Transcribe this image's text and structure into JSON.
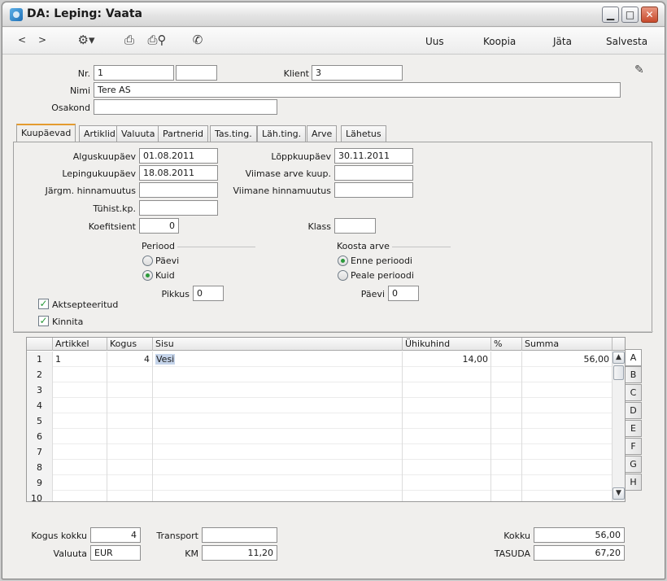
{
  "window": {
    "title": "DA: Leping: Vaata"
  },
  "toolbar": {
    "back": "<",
    "forward": ">",
    "new": "Uus",
    "copy": "Koopia",
    "skip": "Jäta",
    "save": "Salvesta"
  },
  "header": {
    "nr_label": "Nr.",
    "nr_value": "1",
    "nr_value2": "",
    "client_label": "Klient",
    "client_value": "3",
    "name_label": "Nimi",
    "name_value": "Tere AS",
    "dept_label": "Osakond",
    "dept_value": ""
  },
  "tabs": [
    "Kuupäevad",
    "Artiklid",
    "Valuuta",
    "Partnerid",
    "Tas.ting.",
    "Läh.ting.",
    "Arve",
    "Lähetus"
  ],
  "dates": {
    "start_label": "Alguskuupäev",
    "start_value": "01.08.2011",
    "contract_label": "Lepingukuupäev",
    "contract_value": "18.08.2011",
    "next_price_label": "Järgm. hinnamuutus",
    "next_price_value": "",
    "cancel_label": "Tühist.kp.",
    "cancel_value": "",
    "coef_label": "Koefitsient",
    "coef_value": "0",
    "end_label": "Lõppkuupäev",
    "end_value": "30.11.2011",
    "last_inv_label": "Viimase arve kuup.",
    "last_inv_value": "",
    "last_price_label": "Viimane hinnamuutus",
    "last_price_value": "",
    "class_label": "Klass",
    "class_value": ""
  },
  "period": {
    "title": "Periood",
    "opt_days": "Päevi",
    "opt_month": "Kuid",
    "length_label": "Pikkus",
    "length_value": "0"
  },
  "invoice": {
    "title": "Koosta arve",
    "opt_before": "Enne perioodi",
    "opt_after": "Peale perioodi",
    "days_label": "Päevi",
    "days_value": "0"
  },
  "checks": {
    "accepted": "Aktsepteeritud",
    "approve": "Kinnita",
    "check_mark": "✓"
  },
  "grid": {
    "headers": [
      "",
      "Artikkel",
      "Kogus",
      "Sisu",
      "Ühikuhind",
      "%",
      "Summa"
    ],
    "rows": [
      {
        "n": "1",
        "item": "1",
        "qty": "4",
        "desc": "Vesi",
        "price": "14,00",
        "pct": "",
        "sum": "56,00"
      },
      {
        "n": "2",
        "item": "",
        "qty": "",
        "desc": "",
        "price": "",
        "pct": "",
        "sum": ""
      },
      {
        "n": "3",
        "item": "",
        "qty": "",
        "desc": "",
        "price": "",
        "pct": "",
        "sum": ""
      },
      {
        "n": "4",
        "item": "",
        "qty": "",
        "desc": "",
        "price": "",
        "pct": "",
        "sum": ""
      },
      {
        "n": "5",
        "item": "",
        "qty": "",
        "desc": "",
        "price": "",
        "pct": "",
        "sum": ""
      },
      {
        "n": "6",
        "item": "",
        "qty": "",
        "desc": "",
        "price": "",
        "pct": "",
        "sum": ""
      },
      {
        "n": "7",
        "item": "",
        "qty": "",
        "desc": "",
        "price": "",
        "pct": "",
        "sum": ""
      },
      {
        "n": "8",
        "item": "",
        "qty": "",
        "desc": "",
        "price": "",
        "pct": "",
        "sum": ""
      },
      {
        "n": "9",
        "item": "",
        "qty": "",
        "desc": "",
        "price": "",
        "pct": "",
        "sum": ""
      },
      {
        "n": "10",
        "item": "",
        "qty": "",
        "desc": "",
        "price": "",
        "pct": "",
        "sum": ""
      }
    ],
    "side_tabs": [
      "A",
      "B",
      "C",
      "D",
      "E",
      "F",
      "G",
      "H"
    ]
  },
  "footer": {
    "qty_total_label": "Kogus kokku",
    "qty_total_value": "4",
    "currency_label": "Valuuta",
    "currency_value": "EUR",
    "transport_label": "Transport",
    "transport_value": "",
    "vat_label": "KM",
    "vat_value": "11,20",
    "total_label": "Kokku",
    "total_value": "56,00",
    "pay_label": "TASUDA",
    "pay_value": "67,20"
  },
  "icons": [
    "app-icon",
    "gear-icon",
    "print-icon",
    "print-preview-icon",
    "phone-icon",
    "pin-icon",
    "minimize-icon",
    "maximize-icon",
    "close-icon",
    "scroll-up-icon",
    "scroll-down-icon"
  ],
  "colors": {
    "active_tab_accent": "#e49b2f",
    "check_green": "#2b9a3a",
    "selection": "#c5d4ea"
  }
}
